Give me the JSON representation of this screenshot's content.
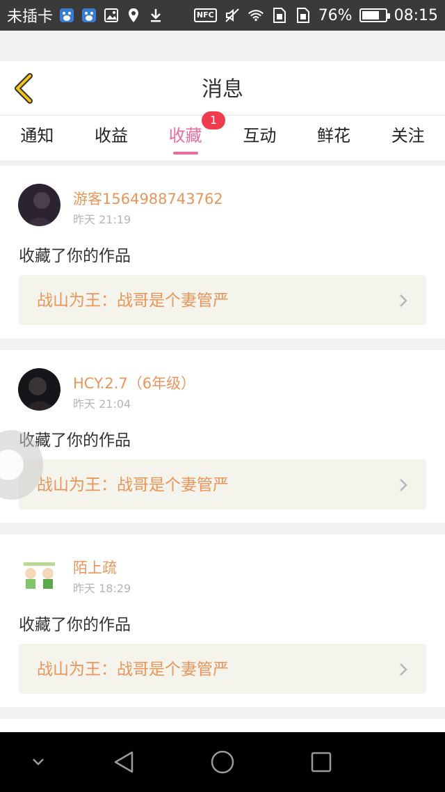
{
  "status_bar": {
    "carrier": "未插卡",
    "nfc_label": "NFC",
    "battery_percent": "76%",
    "battery_level": 0.76,
    "time": "08:15",
    "icons_left": [
      "baidu-icon",
      "baidu-icon",
      "image-icon",
      "location-icon",
      "download-icon"
    ],
    "icons_right": [
      "nfc-icon",
      "mute-icon",
      "wifi-icon",
      "sim-icon",
      "sim-icon",
      "battery-icon"
    ]
  },
  "header": {
    "title": "消息",
    "back_icon": "chevron-left-icon",
    "accent_color": "#f0c419"
  },
  "tabs": [
    {
      "label": "通知"
    },
    {
      "label": "收益"
    },
    {
      "label": "收藏",
      "active": true,
      "badge": "1"
    },
    {
      "label": "互动"
    },
    {
      "label": "鲜花"
    },
    {
      "label": "关注"
    }
  ],
  "feed": [
    {
      "username": "游客1564988743762",
      "time": "昨天 21:19",
      "action": "收藏了你的作品",
      "work_title": "战山为王：战哥是个妻管严"
    },
    {
      "username": "HCY.2.7（6年级）",
      "time": "昨天 21:04",
      "action": "收藏了你的作品",
      "work_title": "战山为王：战哥是个妻管严"
    },
    {
      "username": "陌上疏",
      "time": "昨天 18:29",
      "action": "收藏了你的作品",
      "work_title": "战山为王：战哥是个妻管严"
    }
  ],
  "colors": {
    "active_tab": "#e86c9c",
    "badge": "#ef3b4c",
    "username": "#e9955a",
    "work_bg": "#f5f4ec"
  },
  "nav_bar": {
    "icons": [
      "chevron-down-icon",
      "back-triangle-icon",
      "home-circle-icon",
      "recents-square-icon"
    ]
  }
}
